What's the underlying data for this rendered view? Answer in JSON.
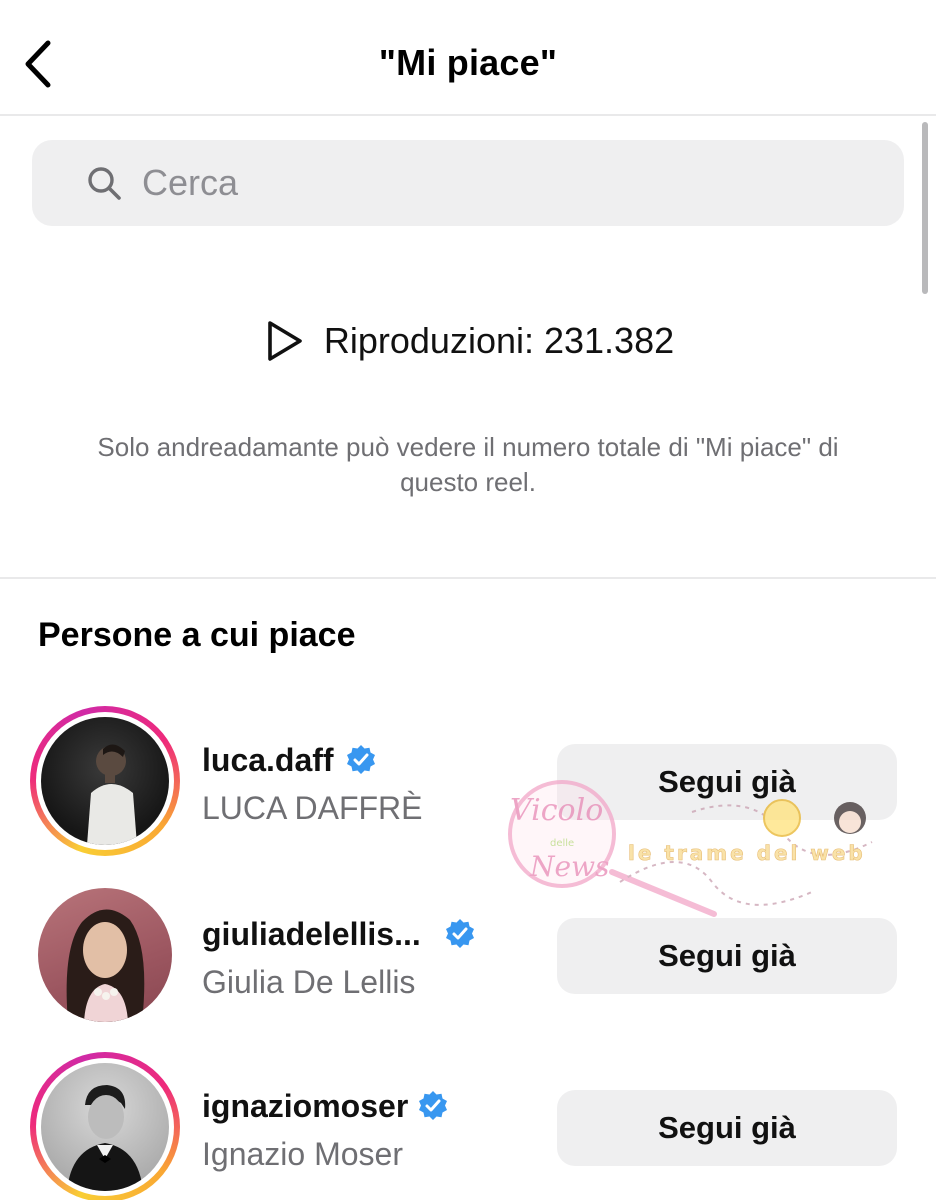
{
  "header": {
    "title": "\"Mi piace\"",
    "back_icon": "chevron-left-icon"
  },
  "search": {
    "placeholder": "Cerca",
    "icon": "search-icon"
  },
  "plays": {
    "icon": "play-icon",
    "label": "Riproduzioni: 231.382"
  },
  "info_text": "Solo andreadamante può vedere il numero totale di \"Mi piace\" di questo reel.",
  "section_title": "Persone a cui piace",
  "users": [
    {
      "username": "luca.daff",
      "full_name": "LUCA DAFFRÈ",
      "verified": true,
      "story_ring": true,
      "button_label": "Segui già"
    },
    {
      "username": "giuliadelellis...",
      "full_name": "Giulia De Lellis",
      "verified": true,
      "story_ring": false,
      "button_label": "Segui già"
    },
    {
      "username": "ignaziomoser",
      "full_name": "Ignazio Moser",
      "verified": true,
      "story_ring": true,
      "button_label": "Segui già"
    }
  ],
  "watermark": {
    "logo_text_top": "Vicolo",
    "logo_text_mid": "delle",
    "logo_text_bottom": "News",
    "tagline": "le trame del web"
  },
  "colors": {
    "verified_blue": "#3897f0",
    "button_bg": "#efeff0",
    "secondary_text": "#6f6f73",
    "story_ring": [
      "#f9ce34",
      "#ee2a7b",
      "#d02aa6"
    ]
  }
}
